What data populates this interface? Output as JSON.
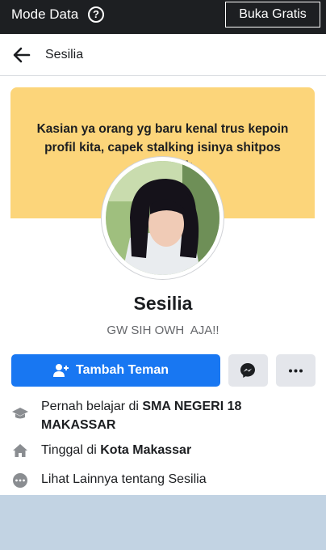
{
  "topbar": {
    "mode_label": "Mode Data",
    "help_icon": "question-circle-icon",
    "free_button": "Buka Gratis"
  },
  "header": {
    "back_icon": "arrow-left-icon",
    "title": "Sesilia"
  },
  "cover": {
    "text": "Kasian ya orang yg baru kenal trus kepoin profil kita, capek stalking isinya shitpos sem...kwk",
    "color": "#fcd57a"
  },
  "profile": {
    "name": "Sesilia",
    "bio": "GW SIH OWH  AJA!!"
  },
  "actions": {
    "add_friend_label": "Tambah Teman",
    "add_friend_icon": "person-add-icon",
    "messenger_icon": "messenger-icon",
    "more_icon": "more-dots-icon",
    "primary_color": "#1877f2"
  },
  "info": {
    "education_prefix": "Pernah belajar di ",
    "education_place": "SMA NEGERI 18 MAKASSAR",
    "education_icon": "graduation-cap-icon",
    "lives_prefix": "Tinggal di ",
    "lives_place": "Kota Makassar",
    "lives_icon": "house-icon",
    "more_label": "Lihat Lainnya tentang Sesilia",
    "more_icon": "ellipsis-circle-icon"
  }
}
